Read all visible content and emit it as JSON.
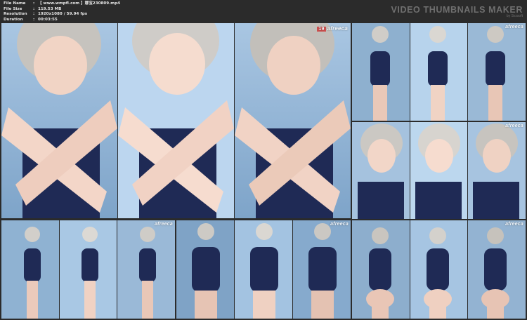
{
  "header": {
    "file_name_label": "File Name",
    "file_name_value": "【 www.wmpfl.com 】娜宝230809.mp4",
    "file_size_label": "File Size",
    "file_size_value": "119.53 MB",
    "resolution_label": "Resolution",
    "resolution_value": "1920x1080 / 59.94 fps",
    "duration_label": "Duration",
    "duration_value": "00:03:55",
    "separator": ":"
  },
  "brand": {
    "title": "VIDEO THUMBNAILS MAKER",
    "subtitle": "by Svzsoft"
  },
  "watermark": {
    "badge": "19",
    "text": "afreeca"
  },
  "colors": {
    "background": "#2b2b2b",
    "header_text": "#e6e6e6",
    "brand_text": "#6f6f6f",
    "swimsuit": "#1f2a55"
  }
}
